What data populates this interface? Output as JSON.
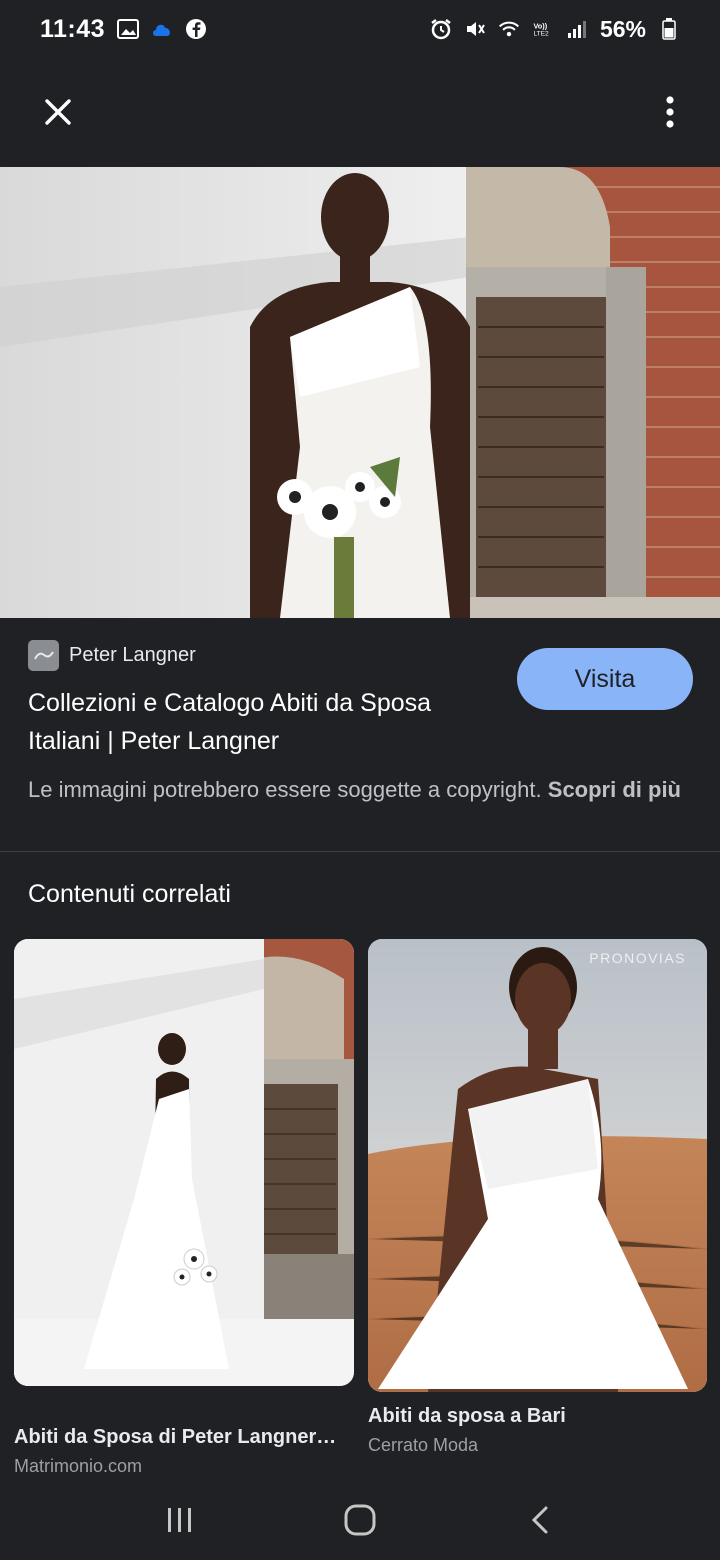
{
  "status_bar": {
    "time": "11:43",
    "battery": "56%",
    "left_icons": [
      "gallery-icon",
      "cloud-icon",
      "facebook-icon"
    ],
    "right_icons": [
      "alarm-icon",
      "mute-icon",
      "wifi-icon",
      "volte-icon",
      "signal-icon",
      "battery-icon"
    ]
  },
  "top_bar": {
    "close_icon": "close-icon",
    "menu_icon": "more-vert-icon"
  },
  "result": {
    "source": "Peter Langner",
    "title": "Collezioni e Catalogo Abiti da Sposa Italiani | Peter Langner",
    "visit_label": "Visita",
    "copyright_text": "Le immagini potrebbero essere soggette a copyright.",
    "learn_more": "Scopri di più"
  },
  "related": {
    "heading": "Contenuti correlati",
    "items": [
      {
        "title": "Abiti da Sposa di Peter Langner…",
        "source": "Matrimonio.com"
      },
      {
        "title": "Abiti da sposa a Bari",
        "source": "Cerrato Moda",
        "watermark": "PRONOVIAS"
      }
    ]
  },
  "nav_bar": {
    "icons": [
      "recents-icon",
      "home-icon",
      "back-icon"
    ]
  },
  "colors": {
    "background": "#202124",
    "accent": "#8ab4f8"
  }
}
